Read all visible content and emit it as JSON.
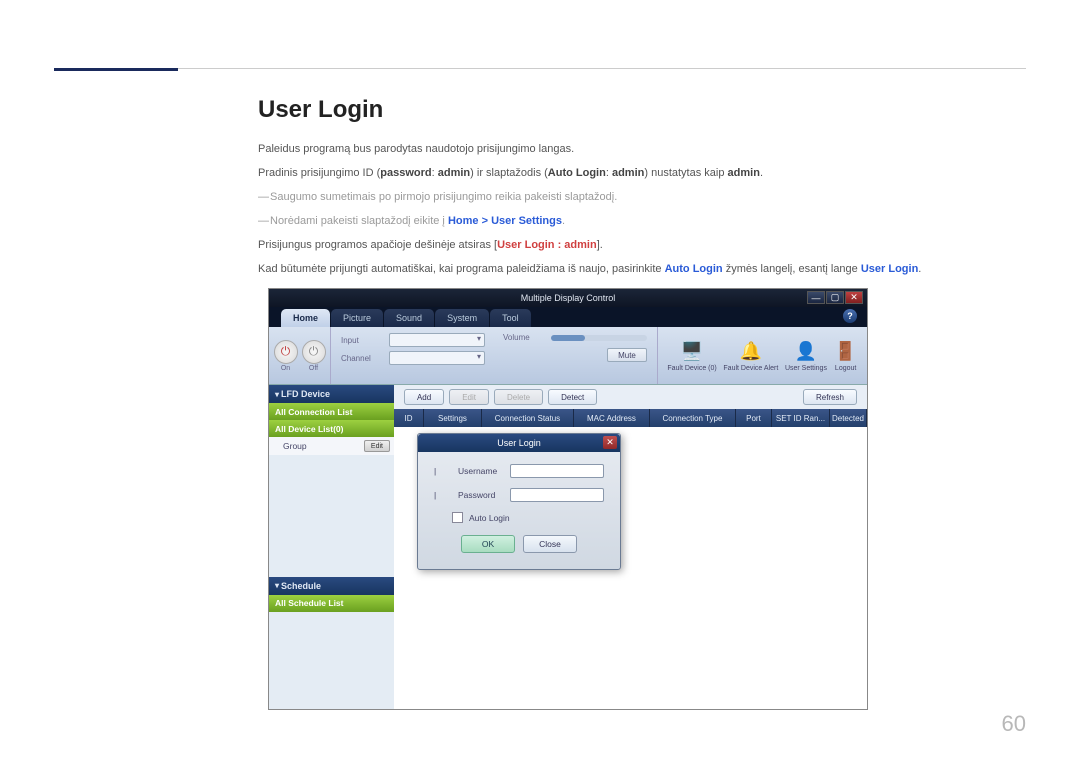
{
  "page": {
    "title": "User Login",
    "p1": "Paleidus programą bus parodytas naudotojo prisijungimo langas.",
    "p2_a": "Pradinis prisijungimo ID (",
    "p2_pw": "password",
    "p2_b": ": ",
    "p2_admin1": "admin",
    "p2_c": ") ir slaptažodis (",
    "p2_auto": "Auto Login",
    "p2_d": ": ",
    "p2_admin2": "admin",
    "p2_e": ") nustatytas kaip ",
    "p2_admin3": "admin",
    "p2_f": ".",
    "note1": "Saugumo sumetimais po pirmojo prisijungimo reikia pakeisti slaptažodį.",
    "note2_a": "Norėdami pakeisti slaptažodį eikite į",
    "note2_home": "Home",
    "note2_sep": ">",
    "note2_us": "User Settings",
    "note2_end": ".",
    "p3_a": "Prisijungus programos apačioje dešinėje atsiras [",
    "p3_login": "User Login : admin",
    "p3_b": "].",
    "p4_a": "Kad būtumėte prijungti automatiškai, kai programa paleidžiama iš naujo, pasirinkite ",
    "p4_auto": "Auto Login",
    "p4_b": " žymės langelį, esantį lange ",
    "p4_userlogin": "User Login",
    "p4_c": ".",
    "number": "60"
  },
  "app": {
    "title": "Multiple Display Control",
    "tabs": {
      "home": "Home",
      "picture": "Picture",
      "sound": "Sound",
      "system": "System",
      "tool": "Tool"
    },
    "help": "?",
    "toolbar": {
      "on": "On",
      "off": "Off",
      "input": "Input",
      "channel": "Channel",
      "volume": "Volume",
      "mute": "Mute",
      "fault_device": "Fault Device (0)",
      "fault_alert": "Fault Device Alert",
      "user_settings": "User Settings",
      "logout": "Logout"
    },
    "sidebar": {
      "lfd": "LFD Device",
      "all_conn": "All Connection List",
      "all_dev": "All Device List(0)",
      "group": "Group",
      "edit": "Edit",
      "schedule": "Schedule",
      "all_sched": "All Schedule List"
    },
    "buttons": {
      "add": "Add",
      "edit": "Edit",
      "delete": "Delete",
      "detect": "Detect",
      "refresh": "Refresh"
    },
    "columns": {
      "id": "ID",
      "settings": "Settings",
      "conn": "Connection Status",
      "mac": "MAC Address",
      "ctype": "Connection Type",
      "port": "Port",
      "setid": "SET ID Ran...",
      "detected": "Detected"
    },
    "dialog": {
      "title": "User Login",
      "username": "Username",
      "password": "Password",
      "bullet": "|",
      "auto": "Auto Login",
      "ok": "OK",
      "close": "Close"
    }
  }
}
